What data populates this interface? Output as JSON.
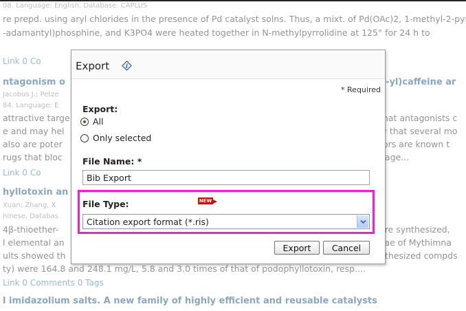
{
  "background": {
    "lines": [
      {
        "text": "08. Language: English, Database: CAPLUS",
        "kind": "small"
      },
      {
        "text": "re prepd. using aryl chlorides in the presence of Pd catalyst solns.  Thus, a mixt. of Pd(OAc)2, 1-methyl-2-pyrrolidone",
        "kind": "text"
      },
      {
        "text": "-adamantyl)phosphine, and K3PO4 were heated together in N-methylpyrrolidine at 125° for 24 h to",
        "kind": "text"
      },
      {
        "text": "Link   0 Co",
        "kind": "links"
      },
      {
        "text": "ntagonism o",
        "kind": "title"
      },
      {
        "text": "Jacobus J.; Petze",
        "kind": "small"
      },
      {
        "text": "84. Language: E",
        "kind": "small"
      },
      {
        "text": "attractive targe",
        "kind": "text"
      },
      {
        "text": "e and may hel",
        "kind": "text"
      },
      {
        "text": "also are poter",
        "kind": "text"
      },
      {
        "text": "rugs that bloc",
        "kind": "text"
      },
      {
        "text": "Link   0 Co",
        "kind": "links"
      },
      {
        "text": "hyllotoxin an",
        "kind": "title"
      },
      {
        "text": "Xuan; Zhang, X",
        "kind": "small"
      },
      {
        "text": "hinese, Databas",
        "kind": "small"
      },
      {
        "text": "4β-thioether-",
        "kind": "text"
      },
      {
        "text": "l elemental an",
        "kind": "text"
      },
      {
        "text": "ults showed th",
        "kind": "text"
      },
      {
        "text": "ty) were 164.8 and 248.1 mg/L, 5.8 and 3.0 times of that of podophyllotoxin, resp....",
        "kind": "text"
      },
      {
        "text": "Link   0 Comments   0 Tags",
        "kind": "links"
      },
      {
        "text": "l imidazolium salts. A new family of highly efficient and reusable catalysts",
        "kind": "title"
      }
    ],
    "right_lines": [
      {
        "text": "1-yl)caffeine ar",
        "kind": "title"
      },
      {
        "text": "that antagonists c",
        "kind": "text"
      },
      {
        "text": "ly that several mo",
        "kind": "text"
      },
      {
        "text": "tors are known t",
        "kind": "text"
      },
      {
        "text": "nage...",
        "kind": "text"
      },
      {
        "text": "ere synthesized,",
        "kind": "text"
      },
      {
        "text": "vae of Mythimna",
        "kind": "text"
      },
      {
        "text": "nthesized compds",
        "kind": "text"
      }
    ]
  },
  "dialog": {
    "title": "Export",
    "required_note": "* Required",
    "export_label": "Export:",
    "options": [
      {
        "label": "All",
        "selected": true
      },
      {
        "label": "Only selected",
        "selected": false
      }
    ],
    "file_name_label": "File Name: *",
    "file_name_value": "Bib Export",
    "file_type_label": "File Type:",
    "new_badge": "NEW",
    "file_type_value": "Citation export format (*.ris)",
    "export_button": "Export",
    "cancel_button": "Cancel"
  },
  "colors": {
    "highlight": "#ff18d8",
    "link": "#4a7ab0",
    "title": "#2a5f8f"
  }
}
